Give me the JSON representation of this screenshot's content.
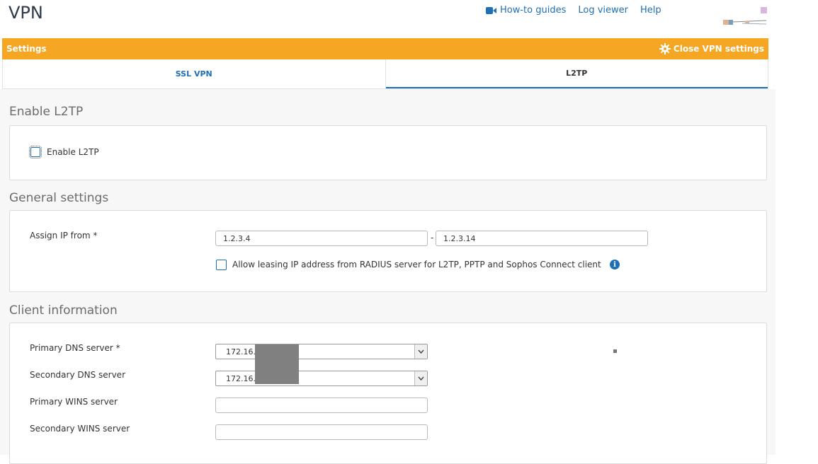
{
  "page": {
    "title": "VPN"
  },
  "top_links": {
    "howto": "How-to guides",
    "log_viewer": "Log viewer",
    "help": "Help"
  },
  "settings_bar": {
    "title": "Settings",
    "close_label": "Close VPN settings"
  },
  "tabs": [
    {
      "label": "SSL VPN",
      "active": false
    },
    {
      "label": "L2TP",
      "active": true
    }
  ],
  "enable_section": {
    "title": "Enable L2TP",
    "checkbox_label": "Enable L2TP",
    "checked": false
  },
  "general": {
    "title": "General settings",
    "assign_ip_label": "Assign IP from *",
    "ip_from": "1.2.3.4",
    "ip_separator": "-",
    "ip_to": "1.2.3.14",
    "radius_label": "Allow leasing IP address from RADIUS server for L2TP, PPTP and Sophos Connect client",
    "radius_checked": false,
    "info_glyph": "i"
  },
  "client": {
    "title": "Client information",
    "primary_dns_label": "Primary DNS server *",
    "primary_dns_value": "172.16.",
    "secondary_dns_label": "Secondary DNS server",
    "secondary_dns_value": "172.16.",
    "primary_wins_label": "Primary WINS server",
    "primary_wins_value": "",
    "secondary_wins_label": "Secondary WINS server",
    "secondary_wins_value": ""
  },
  "colors": {
    "accent": "#f5a623",
    "link": "#1f6fb6",
    "redaction": "#808080"
  }
}
